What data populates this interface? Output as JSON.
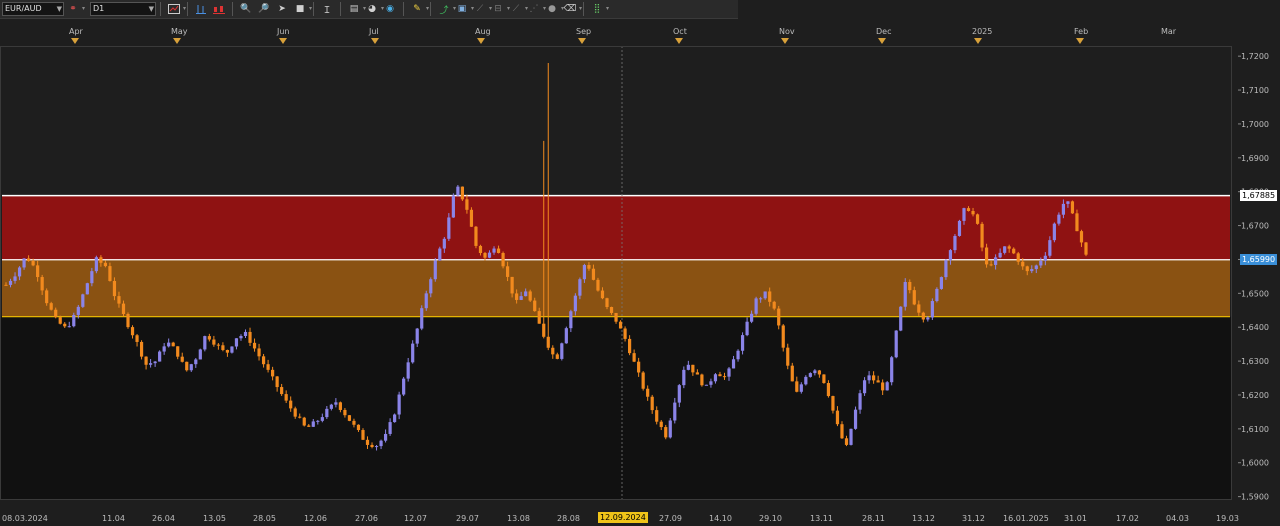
{
  "toolbar": {
    "symbol": "EUR/AUD",
    "timeframe": "D1",
    "icons": [
      "chain-icon",
      "chart-type-icon",
      "bar-chart-icon",
      "candle-chart-icon",
      "zoom-in-icon",
      "zoom-out-icon",
      "cursor-icon",
      "square-icon",
      "text-cursor-icon",
      "folder-icon",
      "palette-icon",
      "globe-icon",
      "pencil-icon",
      "trend-tool-icon",
      "window-icon",
      "line-tool-icon",
      "channel-tool-icon",
      "ray-tool-icon",
      "fib-tool-icon",
      "circle-icon",
      "eraser-icon",
      "grid-icon"
    ]
  },
  "months": [
    "Apr",
    "May",
    "Jun",
    "Jul",
    "Aug",
    "Sep",
    "Oct",
    "Nov",
    "Dec",
    "2025",
    "Feb",
    "Mar"
  ],
  "dates": [
    "08.03.2024",
    "11.04",
    "26.04",
    "13.05",
    "28.05",
    "12.06",
    "27.06",
    "12.07",
    "29.07",
    "13.08",
    "28.08",
    "12.09.2024",
    "27.09",
    "14.10",
    "29.10",
    "13.11",
    "28.11",
    "13.12",
    "31.12",
    "16.01.2025",
    "31.01",
    "17.02",
    "04.03",
    "19.03"
  ],
  "selected_date": "12.09.2024",
  "price_axis": [
    "1,7200",
    "1,7100",
    "1,7000",
    "1,6900",
    "1,6800",
    "1,6700",
    "1,6600",
    "1,6500",
    "1,6400",
    "1,6300",
    "1,6200",
    "1,6100",
    "1,6000",
    "1,5900"
  ],
  "price_tags": {
    "upper": "1,67885",
    "lower": "1,65990"
  },
  "colors": {
    "bull": "#8b84e8",
    "bear": "#f28a1e",
    "upper_zone": "#8f1212",
    "lower_zone": "#8a5212",
    "zone_line_top": "#ffffff",
    "zone_line_bottom": "#f2c200",
    "tag_lower": "#3a8fd8"
  },
  "chart_data": {
    "type": "candlestick",
    "symbol": "EUR/AUD",
    "timeframe": "D1",
    "ylim": [
      1.589,
      1.723
    ],
    "zones": [
      {
        "from": 1.6599,
        "to": 1.67885,
        "color": "#8f1212"
      },
      {
        "from": 1.6431,
        "to": 1.6599,
        "color": "#8a5212"
      }
    ],
    "path": [
      1.6525,
      1.656,
      1.661,
      1.657,
      1.648,
      1.642,
      1.6395,
      1.644,
      1.652,
      1.66,
      1.658,
      1.648,
      1.642,
      1.636,
      1.629,
      1.63,
      1.636,
      1.633,
      1.627,
      1.631,
      1.638,
      1.635,
      1.632,
      1.637,
      1.638,
      1.633,
      1.628,
      1.623,
      1.618,
      1.614,
      1.61,
      1.612,
      1.615,
      1.618,
      1.614,
      1.61,
      1.606,
      1.605,
      1.608,
      1.616,
      1.628,
      1.638,
      1.65,
      1.66,
      1.668,
      1.682,
      1.676,
      1.664,
      1.66,
      1.665,
      1.656,
      1.647,
      1.651,
      1.643,
      1.636,
      1.63,
      1.64,
      1.65,
      1.66,
      1.652,
      1.646,
      1.642,
      1.636,
      1.628,
      1.62,
      1.613,
      1.608,
      1.62,
      1.63,
      1.626,
      1.622,
      1.627,
      1.625,
      1.632,
      1.64,
      1.648,
      1.65,
      1.644,
      1.63,
      1.62,
      1.626,
      1.628,
      1.623,
      1.612,
      1.604,
      1.616,
      1.626,
      1.624,
      1.621,
      1.638,
      1.654,
      1.646,
      1.642,
      1.65,
      1.66,
      1.668,
      1.676,
      1.672,
      1.658,
      1.66,
      1.664,
      1.661,
      1.656,
      1.658,
      1.662,
      1.672,
      1.678,
      1.67,
      1.661
    ]
  }
}
